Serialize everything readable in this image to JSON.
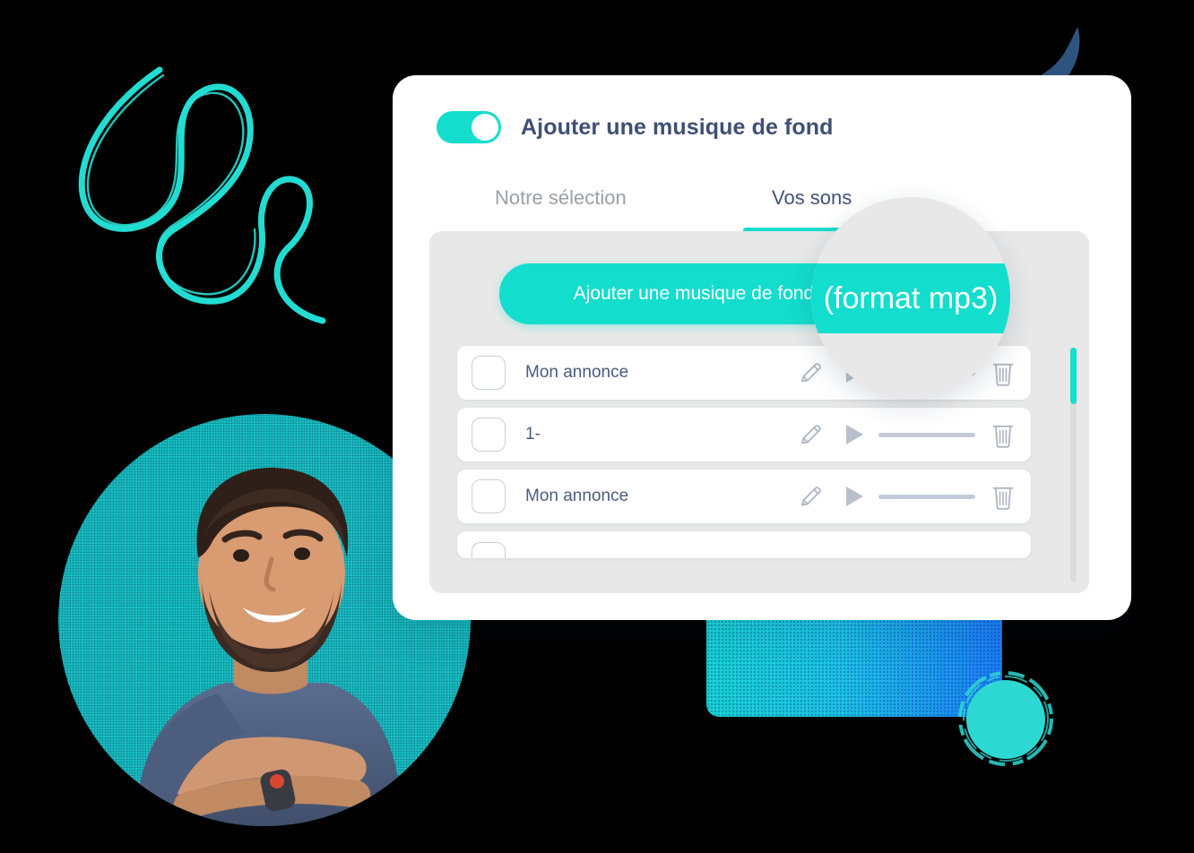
{
  "header": {
    "toggle_state": "on",
    "title": "Ajouter une musique de fond"
  },
  "tabs": [
    {
      "label": "Notre sélection",
      "active": false
    },
    {
      "label": "Vos sons",
      "active": true
    }
  ],
  "upload": {
    "button_label": "Ajouter une musique de fond (format mp3)"
  },
  "magnifier": {
    "zoom_text": "(format mp3)"
  },
  "sound_list": {
    "rows": [
      {
        "name": "Mon annonce",
        "checked": false
      },
      {
        "name": "1-",
        "checked": false
      },
      {
        "name": "Mon annonce",
        "checked": false
      },
      {
        "name": "",
        "checked": false
      }
    ]
  },
  "colors": {
    "accent_teal": "#13ddcd",
    "title_navy": "#3f4f76",
    "tab_inactive": "#9aa0a8",
    "tab_active": "#41527a",
    "panel_gray": "#e8e8e8",
    "row_text": "#4c5c80",
    "leaf_navy": "#2f5480",
    "photo_circle_teal": "#17c4c4",
    "gradient_start": "#19d3cf",
    "gradient_end": "#1d7ef0"
  }
}
